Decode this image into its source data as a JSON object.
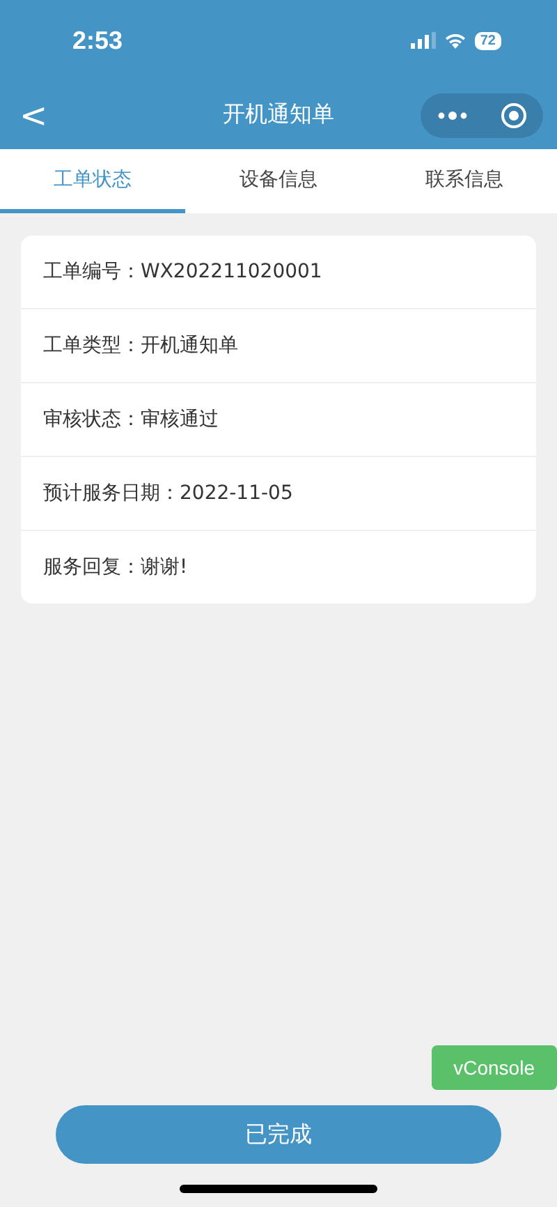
{
  "status_bar": {
    "time": "2:53",
    "battery": "72"
  },
  "nav": {
    "title": "开机通知单",
    "back": "<"
  },
  "tabs": [
    {
      "label": "工单状态",
      "selected": true
    },
    {
      "label": "设备信息",
      "selected": false
    },
    {
      "label": "联系信息",
      "selected": false
    }
  ],
  "details": [
    {
      "label": "工单编号：",
      "value": "WX202211020001"
    },
    {
      "label": "工单类型：",
      "value": "开机通知单"
    },
    {
      "label": "审核状态：",
      "value": "审核通过"
    },
    {
      "label": "预计服务日期：",
      "value": "2022-11-05"
    },
    {
      "label": "服务回复：",
      "value": "谢谢!"
    }
  ],
  "vconsole": "vConsole",
  "action_button": "已完成"
}
